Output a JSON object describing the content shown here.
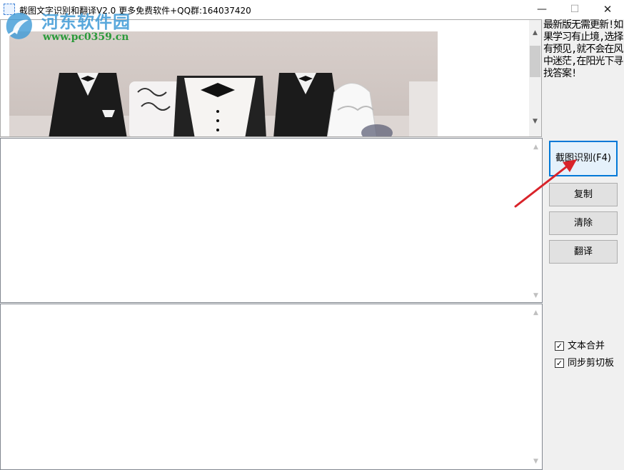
{
  "window": {
    "title": "截图文字识别和翻译V2.0  更多免费软件+QQ群:164037420",
    "minimize_glyph": "—",
    "maximize_glyph": "☐",
    "close_glyph": "✕"
  },
  "watermark": {
    "site_name": "河东软件园",
    "url": "www.pc0359.cn"
  },
  "notice": {
    "text": "最新版无需更新!如果学习有止境,选择有预见,就不会在风中迷茫,在阳光下寻找答案!"
  },
  "buttons": {
    "capture": "截图识别(F4)",
    "copy": "复制",
    "clear": "清除",
    "translate": "翻译"
  },
  "options": {
    "merge_text": {
      "label": "文本合并",
      "checked": true
    },
    "sync_clipboard": {
      "label": "同步剪切板",
      "checked": true
    }
  },
  "scroll": {
    "up_glyph": "▲",
    "down_glyph": "▼"
  },
  "colors": {
    "accent": "#0078d7",
    "annotation_arrow": "#d9232a",
    "watermark_blue": "#3d9ad6",
    "watermark_green": "#2b9a3a"
  }
}
